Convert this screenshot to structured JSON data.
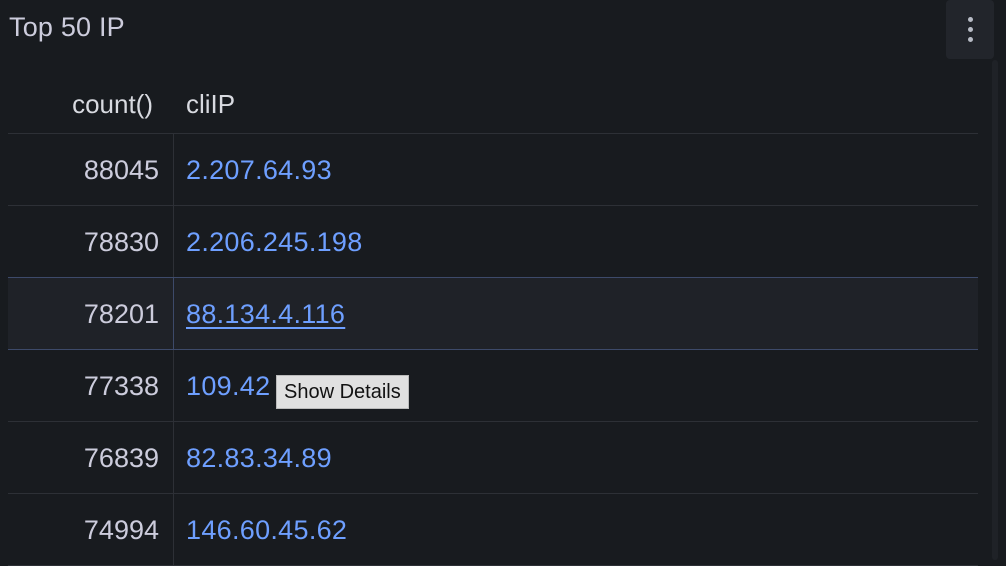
{
  "panel": {
    "title": "Top 50 IP",
    "menu_icon": "vertical-ellipsis-icon"
  },
  "table": {
    "columns": [
      "count()",
      "cliIP"
    ],
    "rows": [
      {
        "count": "88045",
        "ip": "2.207.64.93"
      },
      {
        "count": "78830",
        "ip": "2.206.245.198"
      },
      {
        "count": "78201",
        "ip": "88.134.4.116"
      },
      {
        "count": "77338",
        "ip": "109.42"
      },
      {
        "count": "76839",
        "ip": "82.83.34.89"
      },
      {
        "count": "74994",
        "ip": "146.60.45.62"
      }
    ]
  },
  "tooltip": {
    "text": "Show Details"
  },
  "colors": {
    "background": "#181b1f",
    "link": "#6e9fff",
    "text": "#ccccdc"
  }
}
